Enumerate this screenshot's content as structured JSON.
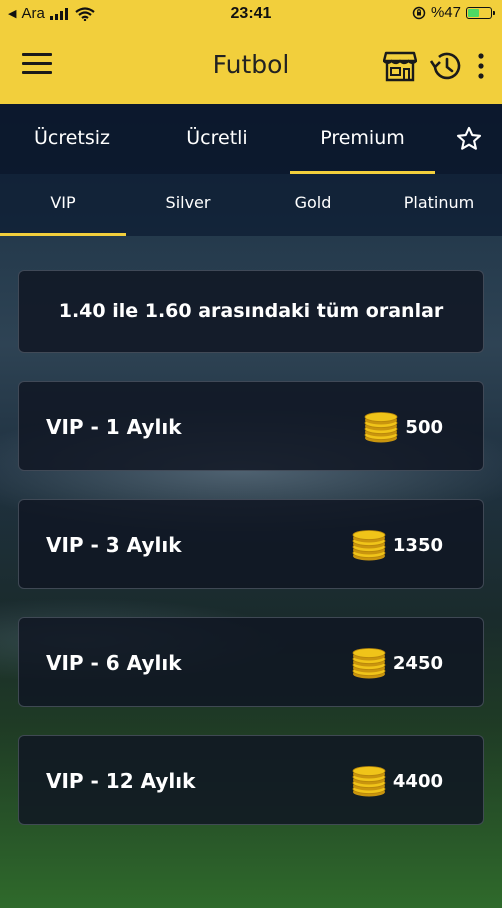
{
  "status_bar": {
    "carrier": "Ara",
    "time": "23:41",
    "battery_text": "%47",
    "battery_level": 0.47
  },
  "header": {
    "title": "Futbol",
    "icons": [
      "menu-icon",
      "store-icon",
      "history-icon",
      "more-vert-icon"
    ]
  },
  "tabs": [
    {
      "label": "Ücretsiz",
      "active": false
    },
    {
      "label": "Ücretli",
      "active": false
    },
    {
      "label": "Premium",
      "active": true
    }
  ],
  "favorite_icon": "star-outline-icon",
  "subtabs": [
    {
      "label": "VIP",
      "active": true
    },
    {
      "label": "Silver",
      "active": false
    },
    {
      "label": "Gold",
      "active": false
    },
    {
      "label": "Platinum",
      "active": false
    }
  ],
  "banner": {
    "text": "1.40 ile 1.60 arasındaki tüm oranlar"
  },
  "packages": [
    {
      "name": "VIP - 1 Aylık",
      "price": "500"
    },
    {
      "name": "VIP - 3 Aylık",
      "price": "1350"
    },
    {
      "name": "VIP - 6 Aylık",
      "price": "2450"
    },
    {
      "name": "VIP - 12 Aylık",
      "price": "4400"
    }
  ],
  "colors": {
    "accent": "#f2cf3c",
    "coin": "#f0c419"
  }
}
